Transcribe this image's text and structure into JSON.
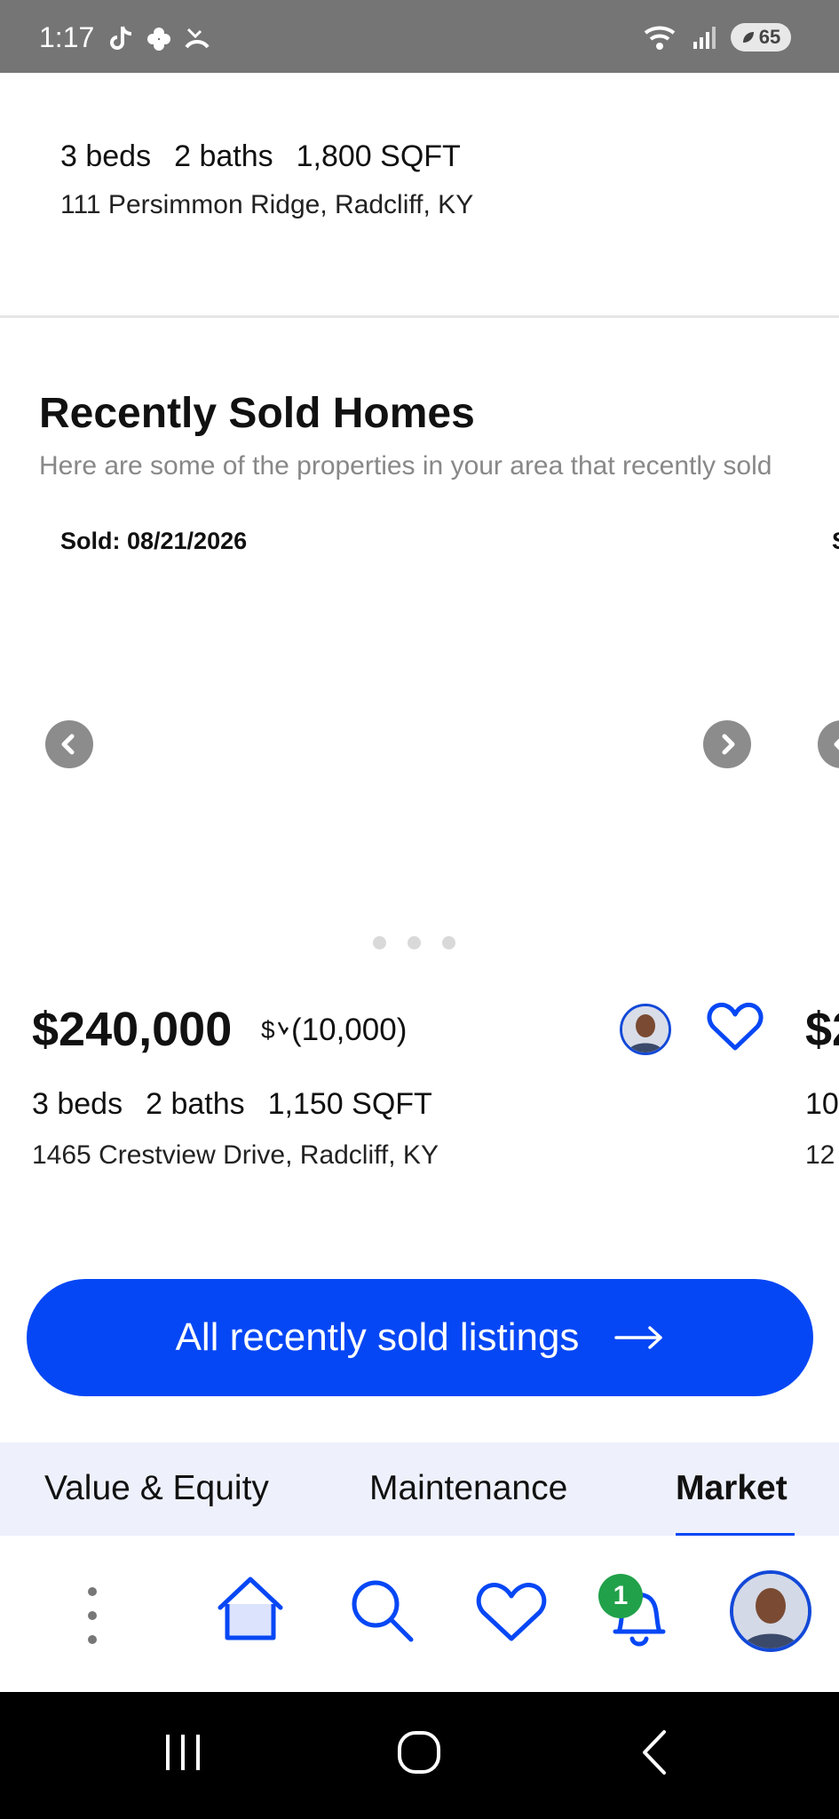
{
  "status_bar": {
    "time": "1:17",
    "network": "6",
    "battery": "65"
  },
  "top_listing": {
    "beds": "3 beds",
    "baths": "2 baths",
    "sqft": "1,800 SQFT",
    "address": "111 Persimmon Ridge, Radcliff, KY"
  },
  "section": {
    "title": "Recently Sold Homes",
    "subtitle": "Here are some of the properties in your area that recently sold"
  },
  "carousel": {
    "sold_label": "Sold: 08/21/2026",
    "sold_label_edge": "S",
    "dots": 3
  },
  "listing": {
    "price": "$240,000",
    "price_change": "(10,000)",
    "beds": "3 beds",
    "baths": "2 baths",
    "sqft": "1,150 SQFT",
    "address": "1465 Crestview Drive, Radcliff, KY"
  },
  "next_listing_edge": {
    "price": "$2",
    "stats": "10",
    "address": "12"
  },
  "cta": {
    "label": "All recently sold listings"
  },
  "tabs": [
    {
      "label": "Value & Equity",
      "active": false
    },
    {
      "label": "Maintenance",
      "active": false
    },
    {
      "label": "Market",
      "active": true
    }
  ],
  "bottom_nav": {
    "notification_count": "1"
  },
  "colors": {
    "primary": "#0647f5",
    "badge": "#21a14a",
    "status_bar": "#757575"
  }
}
